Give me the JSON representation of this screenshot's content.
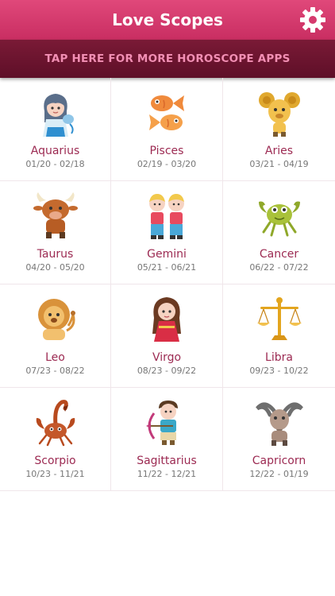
{
  "header": {
    "title": "Love Scopes"
  },
  "promo": {
    "label": "TAP HERE FOR MORE HOROSCOPE APPS"
  },
  "signs": [
    {
      "name": "Aquarius",
      "dates": "01/20 - 02/18",
      "icon": "aquarius-icon"
    },
    {
      "name": "Pisces",
      "dates": "02/19 - 03/20",
      "icon": "pisces-icon"
    },
    {
      "name": "Aries",
      "dates": "03/21 - 04/19",
      "icon": "aries-icon"
    },
    {
      "name": "Taurus",
      "dates": "04/20 - 05/20",
      "icon": "taurus-icon"
    },
    {
      "name": "Gemini",
      "dates": "05/21 - 06/21",
      "icon": "gemini-icon"
    },
    {
      "name": "Cancer",
      "dates": "06/22 - 07/22",
      "icon": "cancer-icon"
    },
    {
      "name": "Leo",
      "dates": "07/23 - 08/22",
      "icon": "leo-icon"
    },
    {
      "name": "Virgo",
      "dates": "08/23 - 09/22",
      "icon": "virgo-icon"
    },
    {
      "name": "Libra",
      "dates": "09/23 - 10/22",
      "icon": "libra-icon"
    },
    {
      "name": "Scorpio",
      "dates": "10/23 - 11/21",
      "icon": "scorpio-icon"
    },
    {
      "name": "Sagittarius",
      "dates": "11/22 - 12/21",
      "icon": "sagittarius-icon"
    },
    {
      "name": "Capricorn",
      "dates": "12/22 - 01/19",
      "icon": "capricorn-icon"
    }
  ],
  "colors": {
    "header": "#d63a6e",
    "promo_bg": "#6b1430",
    "promo_text": "#f28fb4",
    "sign_name": "#9c2a52"
  }
}
